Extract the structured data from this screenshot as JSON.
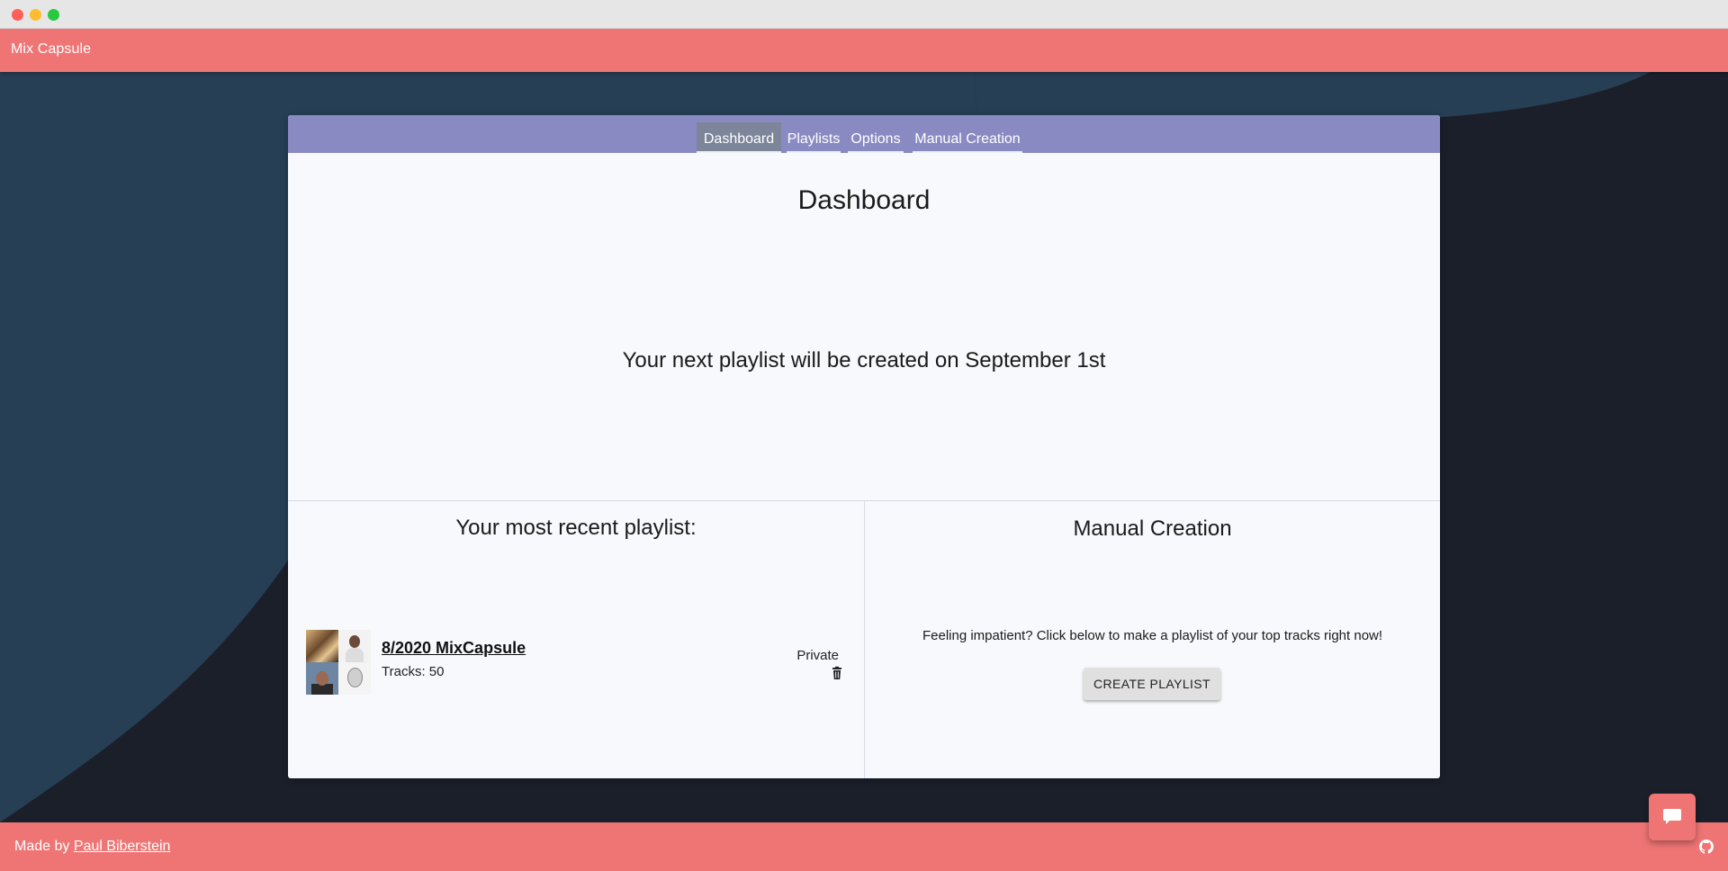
{
  "app": {
    "title": "Mix Capsule"
  },
  "tabs": [
    {
      "label": "Dashboard",
      "active": true
    },
    {
      "label": "Playlists",
      "active": false
    },
    {
      "label": "Options",
      "active": false
    },
    {
      "label": "Manual Creation",
      "active": false
    }
  ],
  "dashboard": {
    "title": "Dashboard",
    "next_playlist_text": "Your next playlist will be created on September 1st"
  },
  "recent": {
    "heading": "Your most recent playlist:",
    "playlist": {
      "name": "8/2020 MixCapsule",
      "tracks": "Tracks: 50",
      "privacy": "Private",
      "delete_icon": "trash-icon"
    }
  },
  "manual": {
    "heading": "Manual Creation",
    "description": "Feeling impatient? Click below to make a playlist of your top tracks right now!",
    "button_label": "CREATE PLAYLIST"
  },
  "footer": {
    "made_by": "Made by ",
    "author": "Paul Biberstein",
    "icon": "github-icon"
  },
  "chat": {
    "icon": "chat-icon"
  },
  "colors": {
    "brand": "#ef7575",
    "tabbar": "#8a8ac2",
    "background_dark": "#1b1f2a",
    "background_wave": "#263f55"
  }
}
